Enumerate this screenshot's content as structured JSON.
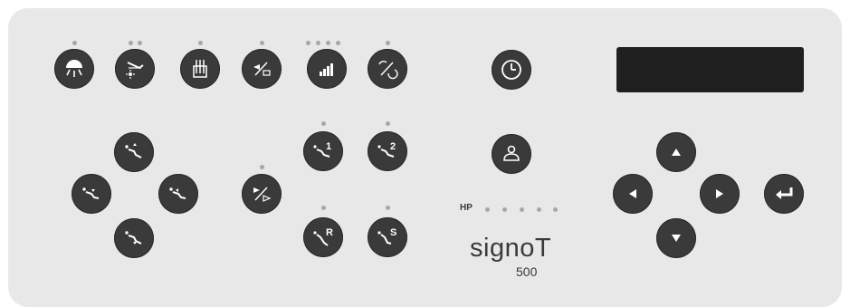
{
  "panel": {
    "hp_label": "HP",
    "brand_name": "signoT",
    "brand_model": "500",
    "display_text": ""
  },
  "buttons": {
    "light": "light-icon",
    "handpiece_light": "handpiece-light-icon",
    "instruments": "instruments-icon",
    "toggle_slash": "toggle-slash-icon",
    "level": "level-bars-icon",
    "rotation": "rotation-icon",
    "timer": "clock-icon",
    "user": "user-icon",
    "chair_up": "chair-up-icon",
    "chair_left": "chair-left-icon",
    "chair_right": "chair-right-icon",
    "chair_down": "chair-down-icon",
    "chair_mode": "chair-mode-icon",
    "memory_1": {
      "label": "1"
    },
    "memory_2": {
      "label": "2"
    },
    "memory_r": {
      "label": "R"
    },
    "memory_s": {
      "label": "S"
    },
    "nav_up": "arrow-up-icon",
    "nav_left": "arrow-left-icon",
    "nav_right": "arrow-right-icon",
    "nav_down": "arrow-down-icon",
    "enter": "enter-icon"
  },
  "colors": {
    "panel_bg": "#e8e8e8",
    "button": "#3a3a3a",
    "led_off": "#a7a7a7",
    "display": "#1f1f1f"
  }
}
